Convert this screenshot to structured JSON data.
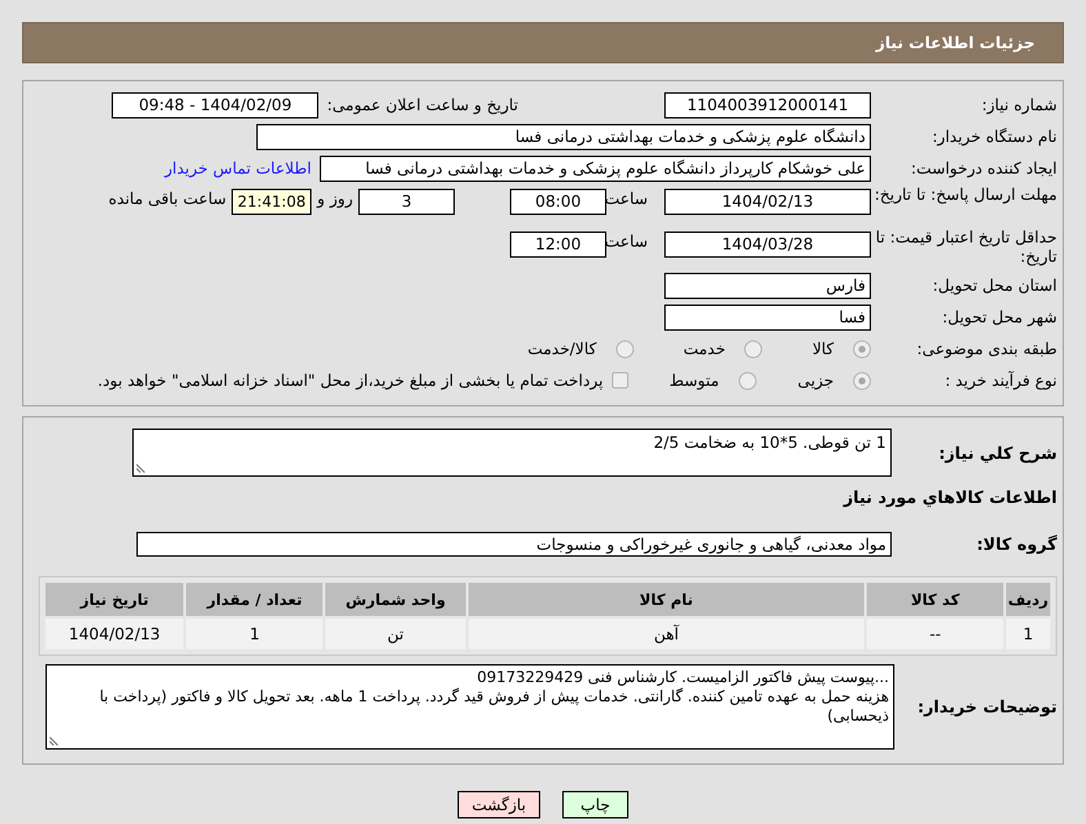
{
  "header": {
    "title": "جزئیات اطلاعات نیاز"
  },
  "need_number": {
    "label": "شماره نیاز:",
    "value": "1104003912000141"
  },
  "announce": {
    "label": "تاریخ و ساعت اعلان عمومی:",
    "value": "1404/02/09 - 09:48"
  },
  "buyer_org": {
    "label": "نام دستگاه خریدار:",
    "value": "دانشگاه علوم پزشکی و خدمات بهداشتی درمانی فسا"
  },
  "requester": {
    "label": "ایجاد کننده درخواست:",
    "value": "علی خوشکام کارپرداز دانشگاه علوم پزشکی و خدمات بهداشتی درمانی فسا",
    "link": "اطلاعات تماس خریدار"
  },
  "reply_deadline": {
    "label": "مهلت ارسال پاسخ: تا تاریخ:",
    "date": "1404/02/13",
    "time_label": "ساعت",
    "time": "08:00",
    "days": "3",
    "days_label": "روز و",
    "remaining": "21:41:08",
    "remaining_label": "ساعت باقی مانده"
  },
  "price_validity": {
    "label": "حداقل تاریخ اعتبار قیمت: تا تاریخ:",
    "date": "1404/03/28",
    "time_label": "ساعت",
    "time": "12:00"
  },
  "province": {
    "label": "استان محل تحویل:",
    "value": "فارس"
  },
  "city": {
    "label": "شهر محل تحویل:",
    "value": "فسا"
  },
  "subject_category": {
    "label": "طبقه بندی موضوعی:",
    "options": [
      {
        "label": "کالا",
        "selected": true
      },
      {
        "label": "خدمت",
        "selected": false
      },
      {
        "label": "کالا/خدمت",
        "selected": false
      }
    ]
  },
  "purchase_process": {
    "label": "نوع فرآیند خرید :",
    "options": [
      {
        "label": "جزیی",
        "selected": true
      },
      {
        "label": "متوسط",
        "selected": false
      }
    ],
    "payment_note": {
      "checked": false,
      "text": "پرداخت تمام یا بخشی از مبلغ خرید،از محل \"اسناد خزانه اسلامی\" خواهد بود."
    }
  },
  "description": {
    "label": "شرح کلي نیاز:",
    "value": "1 تن قوطی. 5*10 به ضخامت 2/5"
  },
  "goods_section": {
    "title": "اطلاعات کالاهاي مورد نیاز"
  },
  "goods_group": {
    "label": "گروه کالا:",
    "value": "مواد معدنی، گیاهی و جانوری غیرخوراکی و منسوجات"
  },
  "table": {
    "columns": [
      "ردیف",
      "کد کالا",
      "نام کالا",
      "واحد شمارش",
      "تعداد / مقدار",
      "تاریخ نیاز"
    ],
    "rows": [
      [
        "1",
        "--",
        "آهن",
        "تن",
        "1",
        "1404/02/13"
      ]
    ]
  },
  "buyer_notes": {
    "label": "توضیحات خریدار:",
    "value": "...پیوست پیش فاکتور الزامیست. کارشناس فنی 09173229429\nهزینه حمل به عهده تامین کننده. گارانتی. خدمات پیش از فروش قید گردد. پرداخت 1 ماهه. بعد تحویل کالا و فاکتور (پرداخت با ذیحسابی)"
  },
  "buttons": [
    {
      "kind": "print",
      "label": "چاپ"
    },
    {
      "kind": "back",
      "label": "بازگشت"
    }
  ]
}
